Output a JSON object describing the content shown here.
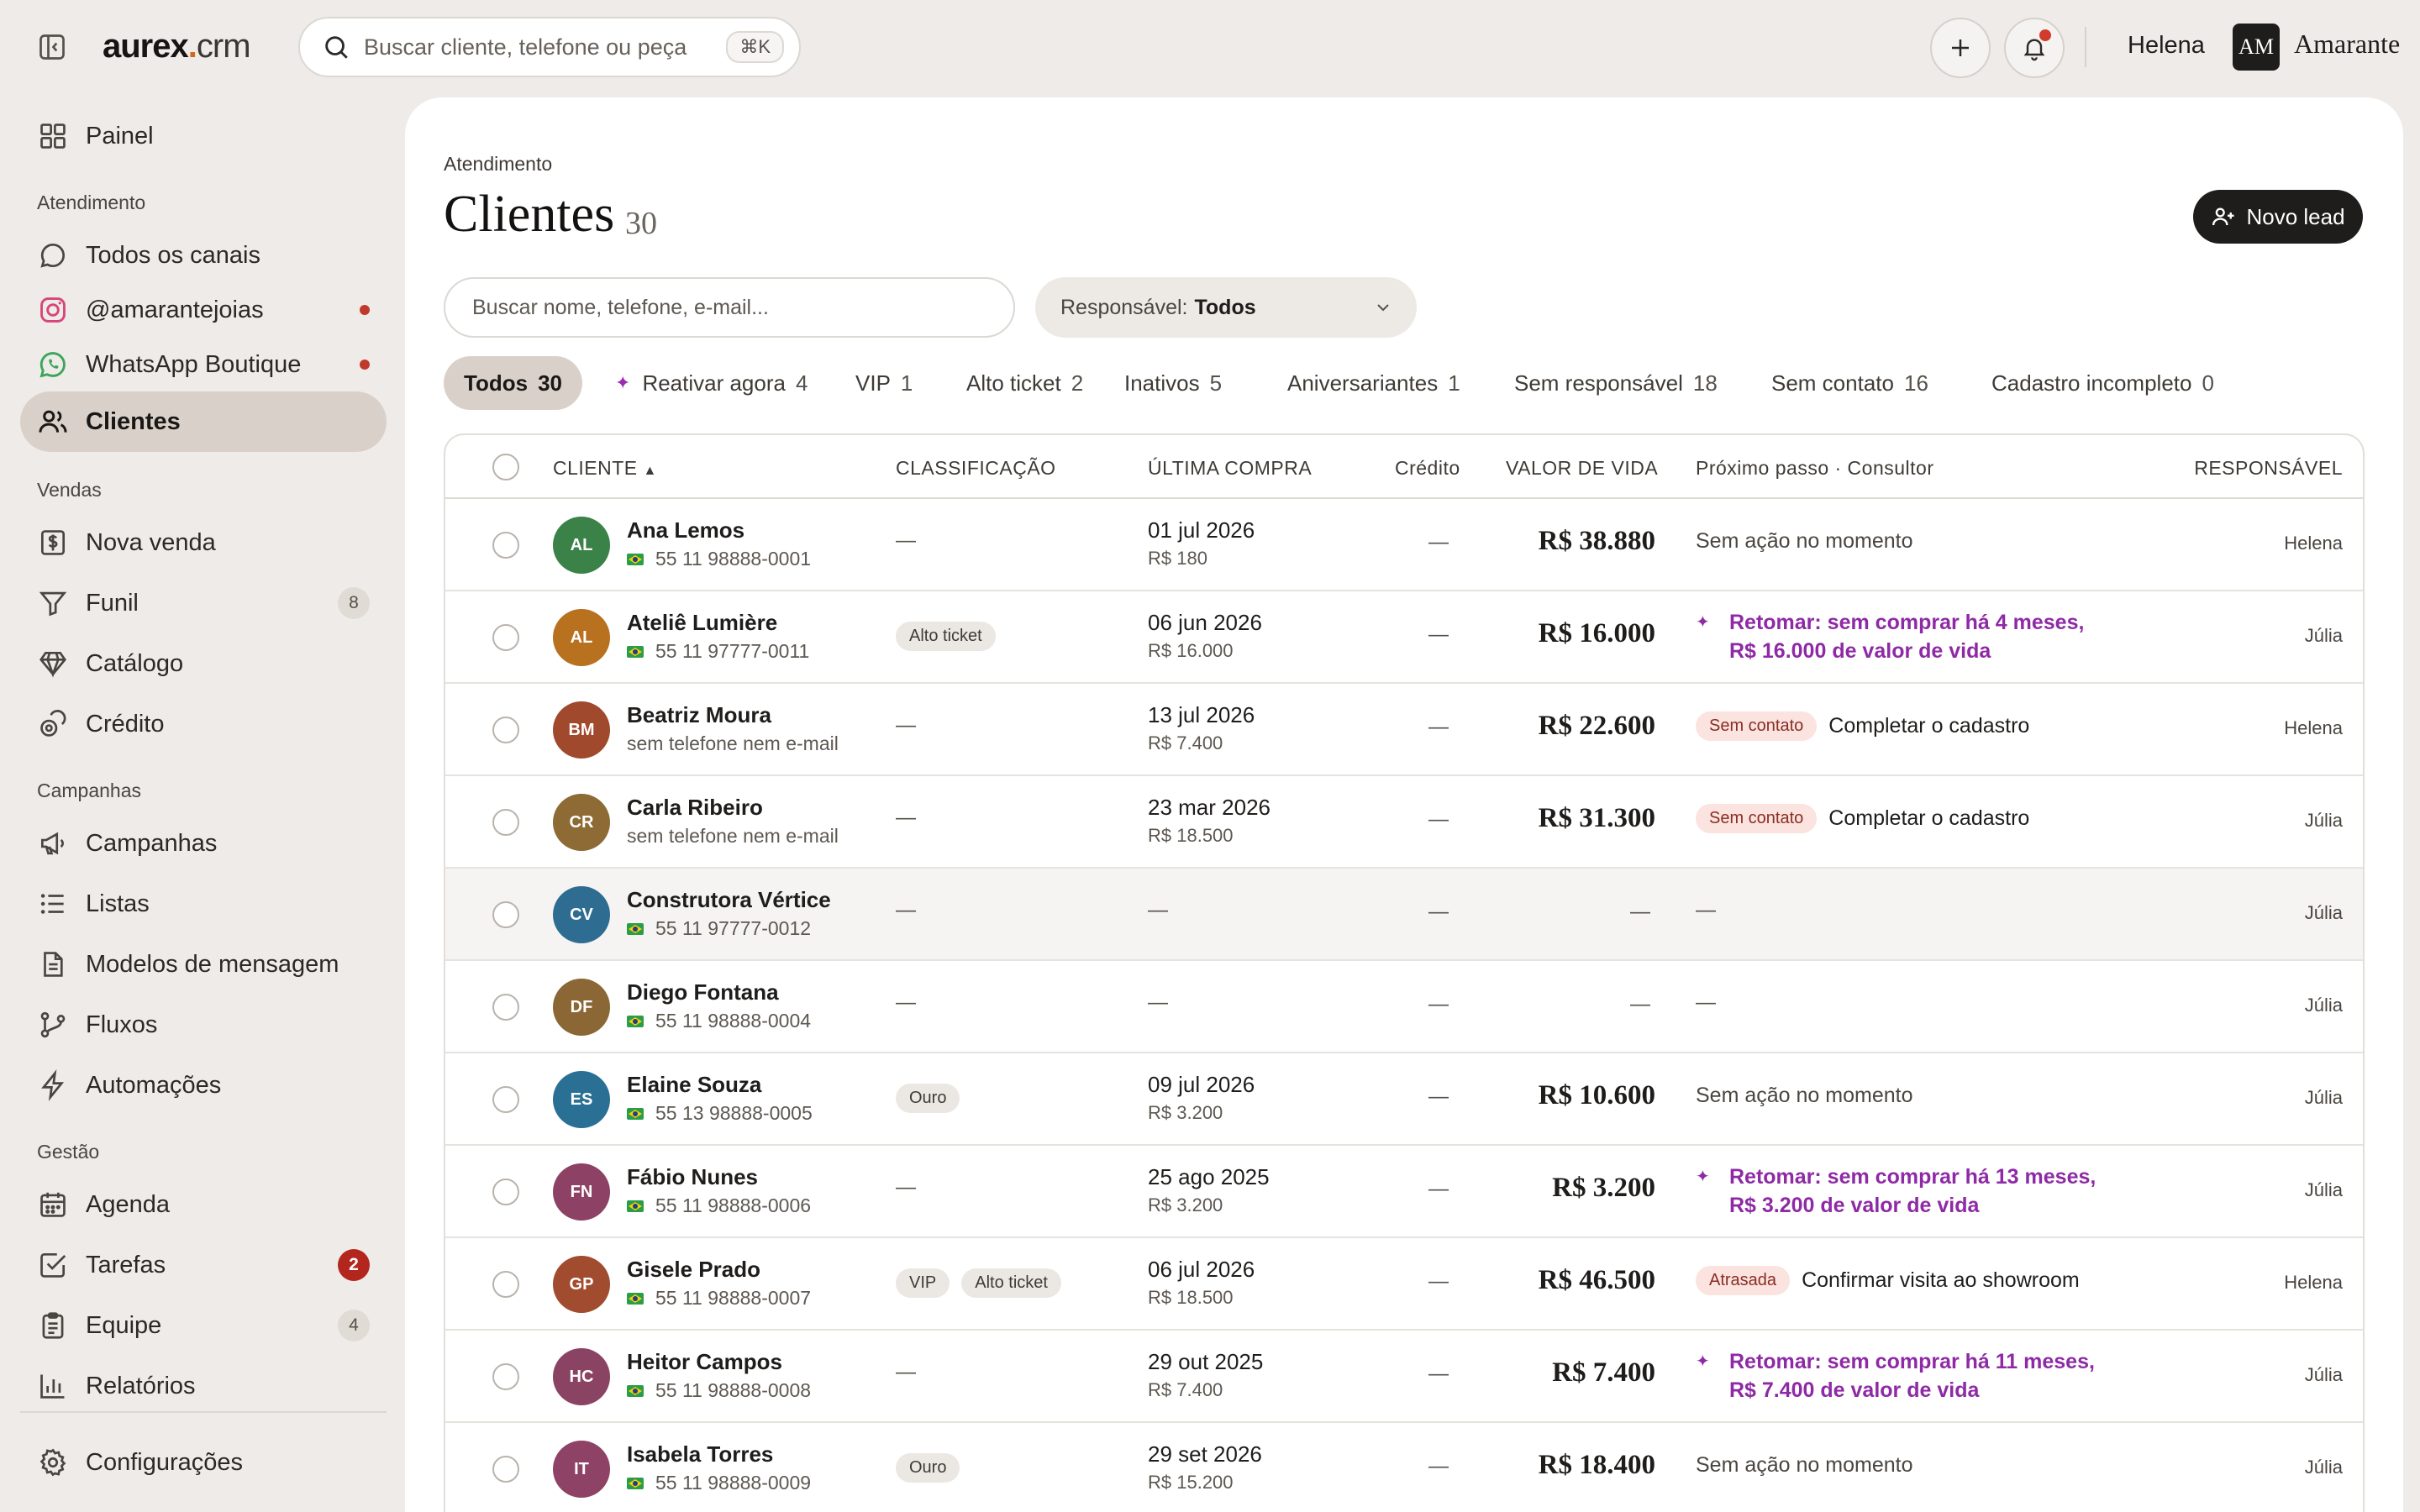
{
  "topbar": {
    "brand_main": "aurex",
    "brand_dot": ".",
    "brand_suffix": "crm",
    "search_placeholder": "Buscar cliente, telefone ou peça",
    "shortcut": "⌘K",
    "user_name": "Helena",
    "org_initials": "AM",
    "org_name": "Amarante"
  },
  "sidebar": {
    "painel": "Painel",
    "sections": {
      "atendimento": "Atendimento",
      "vendas": "Vendas",
      "campanhas": "Campanhas",
      "gestao": "Gestão"
    },
    "items": {
      "todos_canais": "Todos os canais",
      "instagram": "@amarantejoias",
      "whatsapp": "WhatsApp Boutique",
      "clientes": "Clientes",
      "nova_venda": "Nova venda",
      "funil": "Funil",
      "funil_count": "8",
      "catalogo": "Catálogo",
      "credito": "Crédito",
      "campanhas": "Campanhas",
      "listas": "Listas",
      "modelos": "Modelos de mensagem",
      "fluxos": "Fluxos",
      "automacoes": "Automações",
      "agenda": "Agenda",
      "tarefas": "Tarefas",
      "tarefas_count": "2",
      "equipe": "Equipe",
      "equipe_count": "4",
      "relatorios": "Relatórios",
      "configuracoes": "Configurações"
    }
  },
  "main": {
    "breadcrumb": "Atendimento",
    "title": "Clientes",
    "count": "30",
    "new_lead": "Novo lead",
    "search_placeholder": "Buscar nome, telefone, e-mail...",
    "owner_label": "Responsável:",
    "owner_value": "Todos"
  },
  "segments": {
    "todos": {
      "label": "Todos",
      "count": "30"
    },
    "reativar": {
      "label": "Reativar agora",
      "count": "4"
    },
    "vip": {
      "label": "VIP",
      "count": "1"
    },
    "alto": {
      "label": "Alto ticket",
      "count": "2"
    },
    "inativos": {
      "label": "Inativos",
      "count": "5"
    },
    "aniv": {
      "label": "Aniversariantes",
      "count": "1"
    },
    "semresp": {
      "label": "Sem responsável",
      "count": "18"
    },
    "semcont": {
      "label": "Sem contato",
      "count": "16"
    },
    "cadinc": {
      "label": "Cadastro incompleto",
      "count": "0"
    }
  },
  "table": {
    "headers": {
      "cliente": "CLIENTE",
      "sort_indicator": "▲",
      "classificacao": "CLASSIFICAÇÃO",
      "ultima_compra": "ÚLTIMA COMPRA",
      "credito": "Crédito",
      "valor_vida": "VALOR DE VIDA",
      "proximo": "Próximo passo · Consultor",
      "responsavel": "RESPONSÁVEL"
    },
    "dash": "—",
    "rows": [
      {
        "initials": "AL",
        "color": "#3b8249",
        "name": "Ana Lemos",
        "contact": "55 11 98888-0001",
        "has_flag": true,
        "tags": [],
        "date": "01 jul 2026",
        "amount": "R$ 180",
        "ltv": "R$ 38.880",
        "next_kind": "plain",
        "next": "Sem ação no momento",
        "owner": "Helena"
      },
      {
        "initials": "AL",
        "color": "#b7711f",
        "name": "Ateliê Lumière",
        "contact": "55 11 97777-0011",
        "has_flag": true,
        "tags": [
          "Alto ticket"
        ],
        "date": "06 jun 2026",
        "amount": "R$ 16.000",
        "ltv": "R$ 16.000",
        "next_kind": "retomar",
        "next": "Retomar: sem comprar há 4 meses,",
        "next2": "R$ 16.000 de valor de vida",
        "owner": "Júlia"
      },
      {
        "initials": "BM",
        "color": "#a0492c",
        "name": "Beatriz Moura",
        "contact": "sem telefone nem e-mail",
        "has_flag": false,
        "tags": [],
        "date": "13 jul 2026",
        "amount": "R$ 7.400",
        "ltv": "R$ 22.600",
        "next_kind": "badge",
        "badge": "Sem contato",
        "next": "Completar o cadastro",
        "owner": "Helena"
      },
      {
        "initials": "CR",
        "color": "#8e6a34",
        "name": "Carla Ribeiro",
        "contact": "sem telefone nem e-mail",
        "has_flag": false,
        "tags": [],
        "date": "23 mar 2026",
        "amount": "R$ 18.500",
        "ltv": "R$ 31.300",
        "next_kind": "badge",
        "badge": "Sem contato",
        "next": "Completar o cadastro",
        "owner": "Júlia"
      },
      {
        "initials": "CV",
        "color": "#2e6d91",
        "name": "Construtora Vértice",
        "contact": "55 11 97777-0012",
        "has_flag": true,
        "tags": [],
        "date": "",
        "amount": "",
        "ltv": "",
        "next_kind": "dash",
        "next": "",
        "owner": "Júlia"
      },
      {
        "initials": "DF",
        "color": "#8a6734",
        "name": "Diego Fontana",
        "contact": "55 11 98888-0004",
        "has_flag": true,
        "tags": [],
        "date": "",
        "amount": "",
        "ltv": "",
        "next_kind": "dash",
        "next": "",
        "owner": "Júlia"
      },
      {
        "initials": "ES",
        "color": "#2a6f94",
        "name": "Elaine Souza",
        "contact": "55 13 98888-0005",
        "has_flag": true,
        "tags": [
          "Ouro"
        ],
        "date": "09 jul 2026",
        "amount": "R$ 3.200",
        "ltv": "R$ 10.600",
        "next_kind": "plain",
        "next": "Sem ação no momento",
        "owner": "Júlia"
      },
      {
        "initials": "FN",
        "color": "#8d4265",
        "name": "Fábio Nunes",
        "contact": "55 11 98888-0006",
        "has_flag": true,
        "tags": [],
        "date": "25 ago 2025",
        "amount": "R$ 3.200",
        "ltv": "R$ 3.200",
        "next_kind": "retomar",
        "next": "Retomar: sem comprar há 13 meses,",
        "next2": "R$ 3.200 de valor de vida",
        "owner": "Júlia"
      },
      {
        "initials": "GP",
        "color": "#a14b2f",
        "name": "Gisele Prado",
        "contact": "55 11 98888-0007",
        "has_flag": true,
        "tags": [
          "VIP",
          "Alto ticket"
        ],
        "date": "06 jul 2026",
        "amount": "R$ 18.500",
        "ltv": "R$ 46.500",
        "next_kind": "badge",
        "badge": "Atrasada",
        "next": "Confirmar visita ao showroom",
        "owner": "Helena"
      },
      {
        "initials": "HC",
        "color": "#8b4363",
        "name": "Heitor Campos",
        "contact": "55 11 98888-0008",
        "has_flag": true,
        "tags": [],
        "date": "29 out 2025",
        "amount": "R$ 7.400",
        "ltv": "R$ 7.400",
        "next_kind": "retomar",
        "next": "Retomar: sem comprar há 11 meses,",
        "next2": "R$ 7.400 de valor de vida",
        "owner": "Júlia"
      },
      {
        "initials": "IT",
        "color": "#8e4265",
        "name": "Isabela Torres",
        "contact": "55 11 98888-0009",
        "has_flag": true,
        "tags": [
          "Ouro"
        ],
        "date": "29 set 2026",
        "amount": "R$ 15.200",
        "ltv": "R$ 18.400",
        "next_kind": "plain",
        "next": "Sem ação no momento",
        "owner": "Júlia"
      }
    ]
  }
}
